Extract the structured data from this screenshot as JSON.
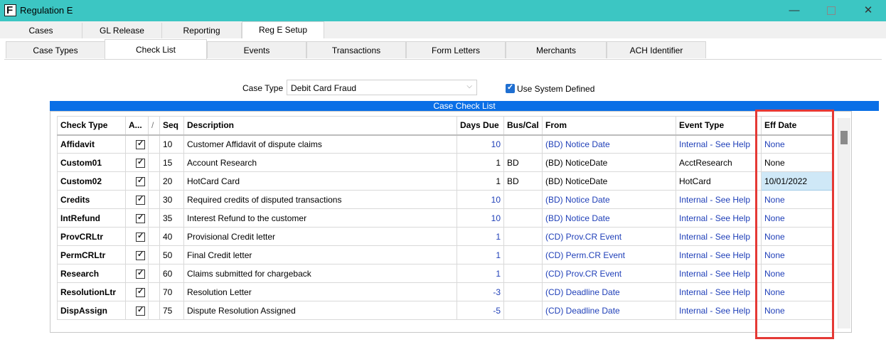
{
  "window": {
    "title": "Regulation E",
    "icon_letter": "F"
  },
  "main_tabs": [
    {
      "label": "Cases"
    },
    {
      "label": "GL Release"
    },
    {
      "label": "Reporting"
    },
    {
      "label": "Reg E Setup",
      "active": true
    }
  ],
  "sub_tabs": [
    {
      "label": "Case Types"
    },
    {
      "label": "Check List",
      "active": true
    },
    {
      "label": "Events"
    },
    {
      "label": "Transactions"
    },
    {
      "label": "Form Letters"
    },
    {
      "label": "Merchants"
    },
    {
      "label": "ACH Identifier"
    }
  ],
  "form": {
    "case_type_label": "Case Type",
    "case_type_value": "Debit Card Fraud",
    "use_system_defined_label": "Use System Defined",
    "use_system_defined_checked": true
  },
  "grid": {
    "title": "Case Check List",
    "columns": [
      "Check Type",
      "A...",
      "/",
      "Seq",
      "Description",
      "Days Due",
      "Bus/Cal",
      "From",
      "Event Type",
      "Eff Date"
    ],
    "rows": [
      {
        "check_type": "Affidavit",
        "seq": "10",
        "description": "Customer Affidavit of dispute claims",
        "days_due": "10",
        "bus_cal": "",
        "from": "(BD) Notice Date",
        "event_type": "Internal - See Help",
        "eff_date": "None"
      },
      {
        "check_type": "Custom01",
        "seq": "15",
        "description": "Account Research",
        "days_due": "1",
        "bus_cal": "BD",
        "from": "(BD) NoticeDate",
        "event_type": "AcctResearch",
        "eff_date": "None"
      },
      {
        "check_type": "Custom02",
        "seq": "20",
        "description": "HotCard Card",
        "days_due": "1",
        "bus_cal": "BD",
        "from": "(BD) NoticeDate",
        "event_type": "HotCard",
        "eff_date": "10/01/2022"
      },
      {
        "check_type": "Credits",
        "seq": "30",
        "description": "Required credits of disputed transactions",
        "days_due": "10",
        "bus_cal": "",
        "from": "(BD) Notice Date",
        "event_type": "Internal - See Help",
        "eff_date": "None"
      },
      {
        "check_type": "IntRefund",
        "seq": "35",
        "description": "Interest Refund to the customer",
        "days_due": "10",
        "bus_cal": "",
        "from": "(BD) Notice Date",
        "event_type": "Internal - See Help",
        "eff_date": "None"
      },
      {
        "check_type": "ProvCRLtr",
        "seq": "40",
        "description": "Provisional Credit letter",
        "days_due": "1",
        "bus_cal": "",
        "from": "(CD) Prov.CR Event",
        "event_type": "Internal - See Help",
        "eff_date": "None"
      },
      {
        "check_type": "PermCRLtr",
        "seq": "50",
        "description": "Final Credit letter",
        "days_due": "1",
        "bus_cal": "",
        "from": "(CD) Perm.CR Event",
        "event_type": "Internal - See Help",
        "eff_date": "None"
      },
      {
        "check_type": "Research",
        "seq": "60",
        "description": "Claims submitted for chargeback",
        "days_due": "1",
        "bus_cal": "",
        "from": "(CD) Prov.CR Event",
        "event_type": "Internal - See Help",
        "eff_date": "None"
      },
      {
        "check_type": "ResolutionLtr",
        "seq": "70",
        "description": "Resolution Letter",
        "days_due": "-3",
        "bus_cal": "",
        "from": "(CD) Deadline Date",
        "event_type": "Internal - See Help",
        "eff_date": "None"
      },
      {
        "check_type": "DispAssign",
        "seq": "75",
        "description": "Dispute Resolution Assigned",
        "days_due": "-5",
        "bus_cal": "",
        "from": "(CD) Deadline Date",
        "event_type": "Internal - See Help",
        "eff_date": "None"
      }
    ]
  },
  "colors": {
    "titlebar": "#3cc6c3",
    "grid_header": "#0a6fe6",
    "link_text": "#1f3fb8",
    "highlight": "#e53935",
    "selected_cell": "#cfe8f7"
  }
}
